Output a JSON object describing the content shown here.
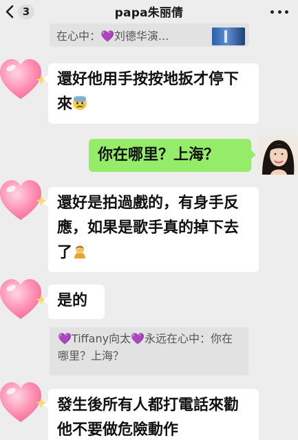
{
  "header": {
    "back_count": "3",
    "title": "papa朱丽倩"
  },
  "messages": {
    "quote_1": "在心中：💜刘德华演...",
    "msg_1": "還好他用手按按地扳才停下來",
    "msg_2": "你在哪里？上海？",
    "msg_3": "還好是拍過戲的，有身手反應，如果是歌手真的掉下去了",
    "msg_4": "是的",
    "quote_2": "💜Tiffany向太💜永远在心中：你在哪里？上海？",
    "msg_5": "發生後所有人都打電話來勸他不要做危險動作"
  },
  "colors": {
    "background": "#ededed",
    "incoming_bubble": "#ffffff",
    "outgoing_bubble": "#95ec69",
    "quote_bubble": "#e2e2e2"
  },
  "icons": {
    "back": "chevron-left-icon",
    "more": "more-dots-icon",
    "emoji_1": "anxious-face-icon",
    "emoji_2": "facepalm-person-icon",
    "avatar": "pink-heart-sparkle-icon"
  }
}
